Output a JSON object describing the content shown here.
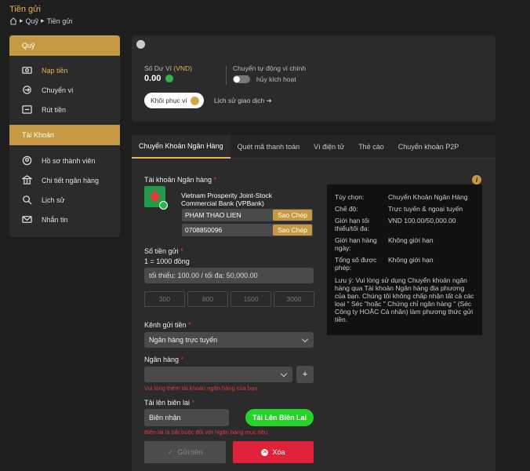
{
  "page": {
    "title": "Tiền gửi",
    "breadcrumb": [
      "Quỹ",
      "Tiền gửi"
    ]
  },
  "sidebar": {
    "section1": "Quỹ",
    "items1": [
      {
        "label": "Nạp tiền",
        "icon": "deposit-icon"
      },
      {
        "label": "Chuyển ví",
        "icon": "transfer-icon"
      },
      {
        "label": "Rút tiền",
        "icon": "withdraw-icon"
      }
    ],
    "section2": "Tài Khoản",
    "items2": [
      {
        "label": "Hồ sơ thành viên",
        "icon": "profile-icon"
      },
      {
        "label": "Chi tiết ngân hàng",
        "icon": "bank-icon"
      },
      {
        "label": "Lịch sử",
        "icon": "history-icon"
      },
      {
        "label": "Nhắn tin",
        "icon": "message-icon"
      }
    ]
  },
  "balance": {
    "label_prefix": "Số Dư Ví",
    "label_currency": "(VND)",
    "amount": "0.00",
    "auto_label": "Chuyển tự động ví chính",
    "toggle_label": "hủy kích hoạt",
    "restore_btn": "Khôi phục ví",
    "history_link": "Lịch sử giao dịch"
  },
  "tabs": [
    "Chuyển Khoản Ngân Hàng",
    "Quét mã thanh toán",
    "Ví điện tử",
    "Thẻ cào",
    "Chuyển khoản P2P"
  ],
  "form": {
    "bank_account_label": "Tài khoản Ngân hàng",
    "bank_name_line1": "Vietnam Prosperity Joint-Stock",
    "bank_name_line2": "Commercial Bank (VPBank)",
    "account_name": "PHAM THAO LIEN",
    "account_number": "0708850096",
    "copy_label": "Sao Chép",
    "amount_label": "Số tiền gửi",
    "rate": "1 = 1000 đồng",
    "amount_placeholder": "tối thiểu: 100.00 / tối đa: 50,000.00",
    "quick_amounts": [
      "300",
      "800",
      "1500",
      "3000"
    ],
    "channel_label": "Kênh gửi tiền",
    "channel_value": "Ngân hàng trực tuyến",
    "bank_label": "Ngân hàng",
    "bank_error": "Vui lòng thêm tài khoản ngân hàng của bạn",
    "receipt_label": "Tải lên biên lai",
    "receipt_placeholder": "Biên nhận",
    "upload_btn": "Tải Lên Biên Lai",
    "receipt_error": "Biên lai là bắt buộc đối với Ngân hàng mục tiêu",
    "submit_btn": "Gửi tiền",
    "delete_btn": "Xóa"
  },
  "info": {
    "rows": [
      {
        "k": "Tùy chọn:",
        "v": "Chuyển Khoản Ngân Hàng"
      },
      {
        "k": "Chế độ:",
        "v": "Trực tuyến & ngoại tuyến"
      },
      {
        "k": "Giới hạn tối thiểu/tối đa:",
        "v": "VND 100.00/50,000.00"
      },
      {
        "k": "Giới hạn hàng ngày:",
        "v": "Không giới hạn"
      },
      {
        "k": "Tổng số được phép:",
        "v": "Không giới hạn"
      }
    ],
    "note": "Lưu ý: Vui lòng sử dụng Chuyển khoản ngân hàng qua Tài khoản Ngân hàng địa phương của bạn. Chúng tôi không chấp nhận tất cả các loại \" Séc \"hoặc \" Chứng chỉ ngân hàng \" (Séc Công ty HOẶC Cá nhân) làm phương thức gửi tiền."
  },
  "colors": {
    "accent": "#c69a45",
    "green": "#27d32a",
    "danger": "#e23b3b"
  }
}
